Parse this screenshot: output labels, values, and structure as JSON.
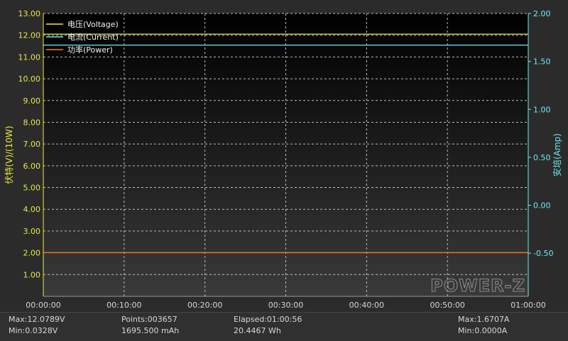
{
  "chart_data": {
    "type": "line",
    "brand": "POWER-Z",
    "y_left_label": "伏特(V)/(10W)",
    "y_right_label": "安培(Amp)",
    "y_left_ticks": [
      "13.00",
      "12.00",
      "11.00",
      "10.00",
      "9.00",
      "8.00",
      "7.00",
      "6.00",
      "5.00",
      "4.00",
      "3.00",
      "2.00",
      "1.00"
    ],
    "y_right_ticks": [
      "2.00",
      "1.50",
      "1.00",
      "0.50",
      "0.00",
      "-0.50"
    ],
    "x_ticks": [
      "00:00:00",
      "00:10:00",
      "00:20:00",
      "00:30:00",
      "00:40:00",
      "00:50:00",
      "01:00:00"
    ],
    "ylim_left": [
      0,
      13
    ],
    "ylim_right": [
      -0.95,
      2.0
    ],
    "xlim_minutes": [
      0,
      60
    ],
    "grid": true,
    "legend_position": "top-left",
    "series": [
      {
        "name": "电压(Voltage)",
        "color": "#e8e84a",
        "axis": "left",
        "x_minutes": [
          0,
          60
        ],
        "values": [
          12.05,
          12.05
        ]
      },
      {
        "name": "电流(Current)",
        "color": "#6fe8f0",
        "axis": "right",
        "x_minutes": [
          0,
          60
        ],
        "values": [
          1.67,
          1.67
        ]
      },
      {
        "name": "功率(Power)",
        "color": "#f07a1a",
        "axis": "left",
        "x_minutes": [
          0,
          60
        ],
        "values": [
          2.01,
          2.01
        ]
      }
    ]
  },
  "stats": {
    "max_voltage": "Max:12.0789V",
    "min_voltage": "Min:0.0328V",
    "points": "Points:003657",
    "capacity_mah": "1695.500 mAh",
    "elapsed": "Elapsed:01:00:56",
    "energy_wh": "20.4467 Wh",
    "max_current": "Max:1.6707A",
    "min_current": "Min:0.0000A"
  }
}
